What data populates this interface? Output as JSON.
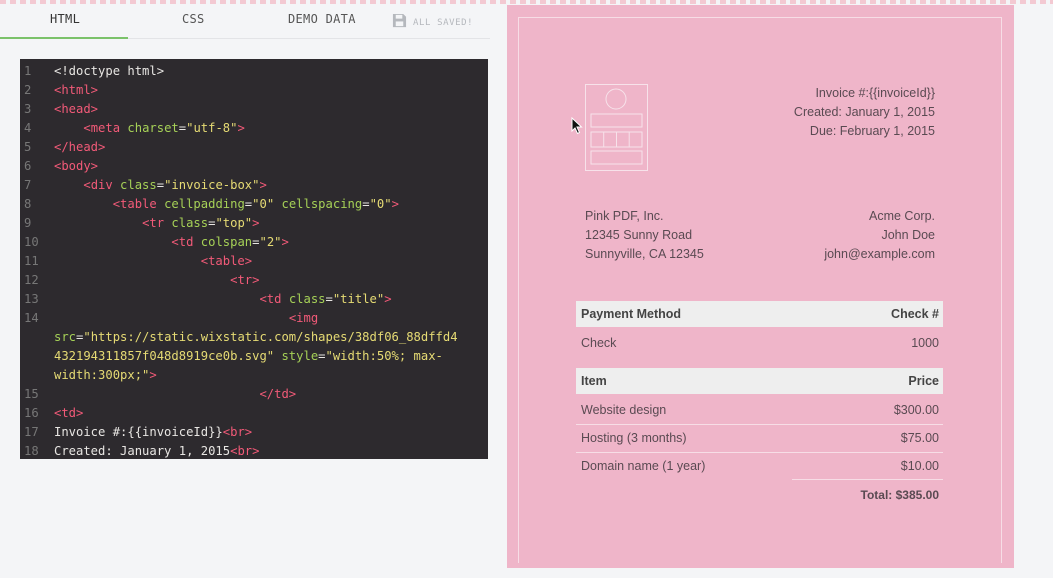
{
  "tabs": {
    "html": "HTML",
    "css": "CSS",
    "demo": "DEMO DATA",
    "save_status": "ALL SAVED!"
  },
  "code_lines": [
    {
      "n": "1",
      "parts": [
        {
          "c": "p",
          "t": "<!doctype html>"
        }
      ]
    },
    {
      "n": "2",
      "parts": [
        {
          "c": "t",
          "t": "<html>"
        }
      ]
    },
    {
      "n": "3",
      "parts": [
        {
          "c": "t",
          "t": "<head>"
        }
      ]
    },
    {
      "n": "4",
      "parts": [
        {
          "c": "p",
          "t": "    "
        },
        {
          "c": "t",
          "t": "<meta "
        },
        {
          "c": "a",
          "t": "charset"
        },
        {
          "c": "p",
          "t": "="
        },
        {
          "c": "s",
          "t": "\"utf-8\""
        },
        {
          "c": "t",
          "t": ">"
        }
      ]
    },
    {
      "n": "5",
      "parts": [
        {
          "c": "t",
          "t": "</head>"
        }
      ]
    },
    {
      "n": "6",
      "parts": [
        {
          "c": "t",
          "t": "<body>"
        }
      ]
    },
    {
      "n": "7",
      "parts": [
        {
          "c": "p",
          "t": "    "
        },
        {
          "c": "t",
          "t": "<div "
        },
        {
          "c": "a",
          "t": "class"
        },
        {
          "c": "p",
          "t": "="
        },
        {
          "c": "s",
          "t": "\"invoice-box\""
        },
        {
          "c": "t",
          "t": ">"
        }
      ]
    },
    {
      "n": "8",
      "parts": [
        {
          "c": "p",
          "t": "        "
        },
        {
          "c": "t",
          "t": "<table "
        },
        {
          "c": "a",
          "t": "cellpadding"
        },
        {
          "c": "p",
          "t": "="
        },
        {
          "c": "s",
          "t": "\"0\" "
        },
        {
          "c": "a",
          "t": "cellspacing"
        },
        {
          "c": "p",
          "t": "="
        },
        {
          "c": "s",
          "t": "\"0\""
        },
        {
          "c": "t",
          "t": ">"
        }
      ]
    },
    {
      "n": "9",
      "parts": [
        {
          "c": "p",
          "t": "            "
        },
        {
          "c": "t",
          "t": "<tr "
        },
        {
          "c": "a",
          "t": "class"
        },
        {
          "c": "p",
          "t": "="
        },
        {
          "c": "s",
          "t": "\"top\""
        },
        {
          "c": "t",
          "t": ">"
        }
      ]
    },
    {
      "n": "10",
      "parts": [
        {
          "c": "p",
          "t": "                "
        },
        {
          "c": "t",
          "t": "<td "
        },
        {
          "c": "a",
          "t": "colspan"
        },
        {
          "c": "p",
          "t": "="
        },
        {
          "c": "s",
          "t": "\"2\""
        },
        {
          "c": "t",
          "t": ">"
        }
      ]
    },
    {
      "n": "11",
      "parts": [
        {
          "c": "p",
          "t": "                    "
        },
        {
          "c": "t",
          "t": "<table>"
        }
      ]
    },
    {
      "n": "12",
      "parts": [
        {
          "c": "p",
          "t": "                        "
        },
        {
          "c": "t",
          "t": "<tr>"
        }
      ]
    },
    {
      "n": "13",
      "parts": [
        {
          "c": "p",
          "t": "                            "
        },
        {
          "c": "t",
          "t": "<td "
        },
        {
          "c": "a",
          "t": "class"
        },
        {
          "c": "p",
          "t": "="
        },
        {
          "c": "s",
          "t": "\"title\""
        },
        {
          "c": "t",
          "t": ">"
        }
      ]
    },
    {
      "n": "14",
      "parts": [
        {
          "c": "p",
          "t": "                                "
        },
        {
          "c": "t",
          "t": "<img"
        }
      ]
    },
    {
      "n": "",
      "parts": [
        {
          "c": "a",
          "t": "src"
        },
        {
          "c": "p",
          "t": "="
        },
        {
          "c": "s",
          "t": "\"https://static.wixstatic.com/shapes/38df06_88dffd4"
        }
      ]
    },
    {
      "n": "",
      "parts": [
        {
          "c": "s",
          "t": "432194311857f048d8919ce0b.svg\" "
        },
        {
          "c": "a",
          "t": "style"
        },
        {
          "c": "p",
          "t": "="
        },
        {
          "c": "s",
          "t": "\"width:50%; max-"
        }
      ]
    },
    {
      "n": "",
      "parts": [
        {
          "c": "s",
          "t": "width:300px;\""
        },
        {
          "c": "t",
          "t": ">"
        }
      ]
    },
    {
      "n": "15",
      "parts": [
        {
          "c": "p",
          "t": "                            "
        },
        {
          "c": "t",
          "t": "</td>"
        }
      ]
    },
    {
      "n": "16",
      "parts": [
        {
          "c": "t",
          "t": "<td>"
        }
      ]
    },
    {
      "n": "17",
      "parts": [
        {
          "c": "p",
          "t": "Invoice #:{{invoiceId}}"
        },
        {
          "c": "t",
          "t": "<br>"
        }
      ]
    },
    {
      "n": "18",
      "parts": [
        {
          "c": "p",
          "t": "Created: January 1, 2015"
        },
        {
          "c": "t",
          "t": "<br>"
        }
      ]
    }
  ],
  "invoice": {
    "meta": [
      "Invoice #:{{invoiceId}}",
      "Created: January 1, 2015",
      "Due: February 1, 2015"
    ],
    "from": [
      "Pink PDF, Inc.",
      "12345 Sunny Road",
      "Sunnyville, CA 12345"
    ],
    "to": [
      "Acme Corp.",
      "John Doe",
      "john@example.com"
    ],
    "payment_head": {
      "left": "Payment Method",
      "right": "Check #"
    },
    "payment_row": {
      "left": "Check",
      "right": "1000"
    },
    "items_head": {
      "left": "Item",
      "right": "Price"
    },
    "items": [
      {
        "name": "Website design",
        "price": "$300.00"
      },
      {
        "name": "Hosting (3 months)",
        "price": "$75.00"
      },
      {
        "name": "Domain name (1 year)",
        "price": "$10.00"
      }
    ],
    "total": "Total: $385.00"
  },
  "icons": {
    "save": "floppy-disk-icon",
    "cursor": "mouse-pointer-icon",
    "logo": "invoice-logo-placeholder"
  },
  "colors": {
    "tab_accent": "#7bc26a",
    "preview_bg": "#efb5c9",
    "editor_bg": "#2d2a2e"
  }
}
